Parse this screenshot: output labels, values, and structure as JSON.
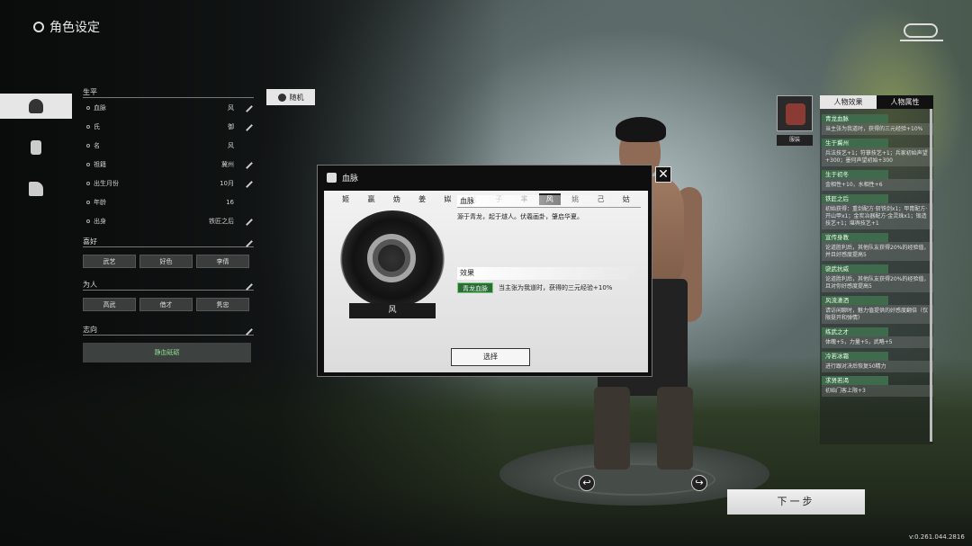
{
  "header": {
    "title": "角色设定",
    "icon": "logo-icon"
  },
  "sidebar": {
    "tabs": [
      {
        "icon": "bust-icon"
      },
      {
        "icon": "cards-icon"
      },
      {
        "icon": "anvil-icon"
      }
    ]
  },
  "form": {
    "life": {
      "section": "生平",
      "rows": [
        {
          "label": "血脉",
          "value": "风"
        },
        {
          "label": "氏",
          "value": "御"
        },
        {
          "label": "名",
          "value": "风"
        },
        {
          "label": "祖籍",
          "value": "冀州"
        },
        {
          "label": "出生月份",
          "value": "10月"
        },
        {
          "label": "年龄",
          "value": "16"
        },
        {
          "label": "出身",
          "value": "铁匠之后"
        }
      ]
    },
    "random_label": "随机",
    "hobby": {
      "section": "喜好",
      "chips": [
        "武艺",
        "好色",
        "李倩"
      ]
    },
    "character": {
      "section": "为人",
      "chips": [
        "高武",
        "借才",
        "隽忠"
      ]
    },
    "ambition": {
      "section": "志向",
      "value": "静血砥砺"
    }
  },
  "dialog": {
    "title": "血脉",
    "tabs": [
      "姬",
      "嬴",
      "妫",
      "姜",
      "姒",
      "姞",
      "子",
      "芈",
      "风",
      "姚",
      "己",
      "姑"
    ],
    "selected_tab": "风",
    "selected_name": "风",
    "info_title": "血脉",
    "description": "源于青龙，起于燧人。伏羲画卦，肇启华夏。",
    "effect_title": "效果",
    "effect_tag": "青龙血脉",
    "effect_text": "当主张为我道时，获得的三元经验+10%",
    "choose_label": "选择",
    "close_label": "✕"
  },
  "right_panel": {
    "equip_label": "服装",
    "tab_active": "人物效果",
    "tab_inactive": "人物属性",
    "traits": [
      {
        "name": "青龙血脉",
        "desc": "当主张为我道时，获得的三元经验+10%"
      },
      {
        "name": "生于冀州",
        "desc": "兵法技艺+1；符箓技艺+1；兵家初始声望+300；墨何声望初始+300"
      },
      {
        "name": "生于初冬",
        "desc": "金相性+10，水相性+6"
      },
      {
        "name": "铁匠之后",
        "desc": "初始获得：重剑配方·斩铁剑x1；甲胄配方·开山甲x1；金炭冶器配方·金灵珠x1；锻造技艺+1；堪舆技艺+1"
      },
      {
        "name": "宣传身教",
        "desc": "论道胜利后，其他队友获得20%的经验值，并且好感度提高5"
      },
      {
        "name": "骁武抗威",
        "desc": "论道胜利后，其他队友获得20%的经验值，且对你好感度提高5"
      },
      {
        "name": "风流潇洒",
        "desc": "请访闲聊时，魅力值提供的好感度翻倍（仅限挺开和弹情）"
      },
      {
        "name": "练武之才",
        "desc": "体魄+5，力量+5，武略+5"
      },
      {
        "name": "冷若冰霜",
        "desc": "进行跟对决后恢复50精力"
      },
      {
        "name": "求贤若渴",
        "desc": "初始门客上限+3"
      }
    ]
  },
  "footer": {
    "next_label": "下一步",
    "version": "v:0.261.044.2816"
  }
}
